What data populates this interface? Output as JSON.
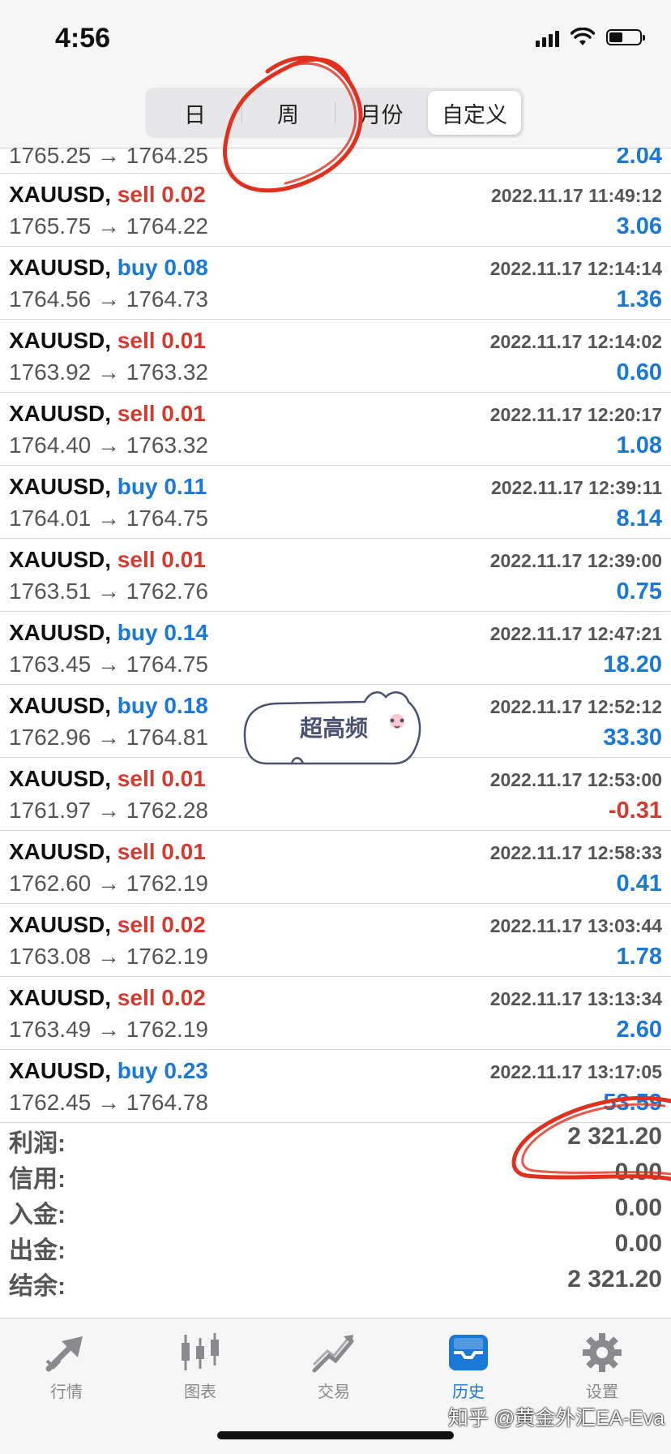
{
  "status_bar": {
    "time": "4:56"
  },
  "segments": [
    {
      "label": "日",
      "active": false
    },
    {
      "label": "周",
      "active": false
    },
    {
      "label": "月份",
      "active": false
    },
    {
      "label": "自定义",
      "active": true
    }
  ],
  "partial_row": {
    "prices": "1765.25 → 1764.25",
    "profit": "2.04"
  },
  "trades": [
    {
      "symbol": "XAUUSD,",
      "side": "sell",
      "volume": "0.02",
      "time": "2022.11.17 11:49:12",
      "prices": "1765.75 → 1764.22",
      "profit": "3.06"
    },
    {
      "symbol": "XAUUSD,",
      "side": "buy",
      "volume": "0.08",
      "time": "2022.11.17 12:14:14",
      "prices": "1764.56 → 1764.73",
      "profit": "1.36"
    },
    {
      "symbol": "XAUUSD,",
      "side": "sell",
      "volume": "0.01",
      "time": "2022.11.17 12:14:02",
      "prices": "1763.92 → 1763.32",
      "profit": "0.60"
    },
    {
      "symbol": "XAUUSD,",
      "side": "sell",
      "volume": "0.01",
      "time": "2022.11.17 12:20:17",
      "prices": "1764.40 → 1763.32",
      "profit": "1.08"
    },
    {
      "symbol": "XAUUSD,",
      "side": "buy",
      "volume": "0.11",
      "time": "2022.11.17 12:39:11",
      "prices": "1764.01 → 1764.75",
      "profit": "8.14"
    },
    {
      "symbol": "XAUUSD,",
      "side": "sell",
      "volume": "0.01",
      "time": "2022.11.17 12:39:00",
      "prices": "1763.51 → 1762.76",
      "profit": "0.75"
    },
    {
      "symbol": "XAUUSD,",
      "side": "buy",
      "volume": "0.14",
      "time": "2022.11.17 12:47:21",
      "prices": "1763.45 → 1764.75",
      "profit": "18.20"
    },
    {
      "symbol": "XAUUSD,",
      "side": "buy",
      "volume": "0.18",
      "time": "2022.11.17 12:52:12",
      "prices": "1762.96 → 1764.81",
      "profit": "33.30"
    },
    {
      "symbol": "XAUUSD,",
      "side": "sell",
      "volume": "0.01",
      "time": "2022.11.17 12:53:00",
      "prices": "1761.97 → 1762.28",
      "profit": "-0.31"
    },
    {
      "symbol": "XAUUSD,",
      "side": "sell",
      "volume": "0.01",
      "time": "2022.11.17 12:58:33",
      "prices": "1762.60 → 1762.19",
      "profit": "0.41"
    },
    {
      "symbol": "XAUUSD,",
      "side": "sell",
      "volume": "0.02",
      "time": "2022.11.17 13:03:44",
      "prices": "1763.08 → 1762.19",
      "profit": "1.78"
    },
    {
      "symbol": "XAUUSD,",
      "side": "sell",
      "volume": "0.02",
      "time": "2022.11.17 13:13:34",
      "prices": "1763.49 → 1762.19",
      "profit": "2.60"
    },
    {
      "symbol": "XAUUSD,",
      "side": "buy",
      "volume": "0.23",
      "time": "2022.11.17 13:17:05",
      "prices": "1762.45 → 1764.78",
      "profit": "53.59"
    }
  ],
  "summary": [
    {
      "label": "利润:",
      "value": "2 321.20"
    },
    {
      "label": "信用:",
      "value": "0.00"
    },
    {
      "label": "入金:",
      "value": "0.00"
    },
    {
      "label": "出金:",
      "value": "0.00"
    },
    {
      "label": "结余:",
      "value": "2 321.20"
    }
  ],
  "sticker": {
    "text": "超高频"
  },
  "tabs": [
    {
      "label": "行情",
      "icon": "quotes-arrows-icon",
      "active": false
    },
    {
      "label": "图表",
      "icon": "candlestick-chart-icon",
      "active": false
    },
    {
      "label": "交易",
      "icon": "trade-chart-icon",
      "active": false
    },
    {
      "label": "历史",
      "icon": "history-inbox-icon",
      "active": true
    },
    {
      "label": "设置",
      "icon": "gear-icon",
      "active": false
    }
  ],
  "watermark": "知乎 @黄金外汇EA-Eva",
  "colors": {
    "sell": "#d43b2e",
    "buy": "#1a78d6",
    "accent": "#1a78d6",
    "scribble": "#e0301e"
  }
}
